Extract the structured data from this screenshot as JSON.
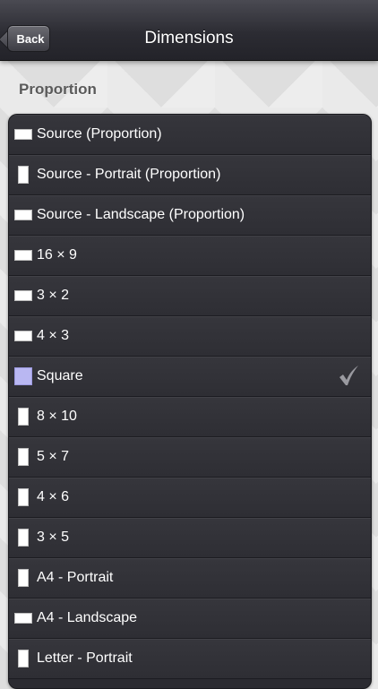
{
  "navbar": {
    "back_label": "Back",
    "title": "Dimensions"
  },
  "section": {
    "header": "Proportion"
  },
  "items": [
    {
      "label": "Source (Proportion)",
      "shape": "landscape",
      "selected": false
    },
    {
      "label": "Source - Portrait (Proportion)",
      "shape": "portrait",
      "selected": false
    },
    {
      "label": "Source - Landscape (Proportion)",
      "shape": "landscape",
      "selected": false
    },
    {
      "label": "16 × 9",
      "shape": "landscape",
      "selected": false
    },
    {
      "label": "3 × 2",
      "shape": "landscape",
      "selected": false
    },
    {
      "label": "4 × 3",
      "shape": "landscape",
      "selected": false
    },
    {
      "label": "Square",
      "shape": "square",
      "selected": true
    },
    {
      "label": "8 × 10",
      "shape": "portrait",
      "selected": false
    },
    {
      "label": "5 × 7",
      "shape": "portrait",
      "selected": false
    },
    {
      "label": "4 × 6",
      "shape": "portrait",
      "selected": false
    },
    {
      "label": "3 × 5",
      "shape": "portrait",
      "selected": false
    },
    {
      "label": "A4 - Portrait",
      "shape": "portrait",
      "selected": false
    },
    {
      "label": "A4 - Landscape",
      "shape": "landscape",
      "selected": false
    },
    {
      "label": "Letter - Portrait",
      "shape": "portrait",
      "selected": false
    }
  ],
  "icons": {
    "selected_marker": "checkmark-icon"
  },
  "colors": {
    "selected_swatch": "#b9b7f2",
    "checkmark": "#9a9aa0"
  }
}
